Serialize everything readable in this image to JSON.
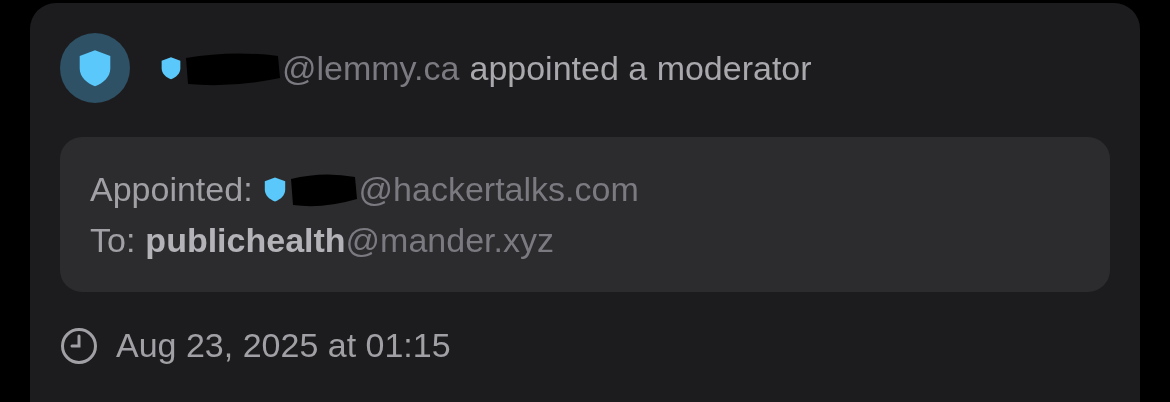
{
  "header": {
    "user_domain": "@lemmy.ca",
    "action": "appointed a moderator"
  },
  "details": {
    "appointed": {
      "label": "Appointed:",
      "domain": "@hackertalks.com"
    },
    "to": {
      "label": "To:",
      "community": "publichealth",
      "domain": "@mander.xyz"
    }
  },
  "timestamp": "Aug 23, 2025 at 01:15"
}
